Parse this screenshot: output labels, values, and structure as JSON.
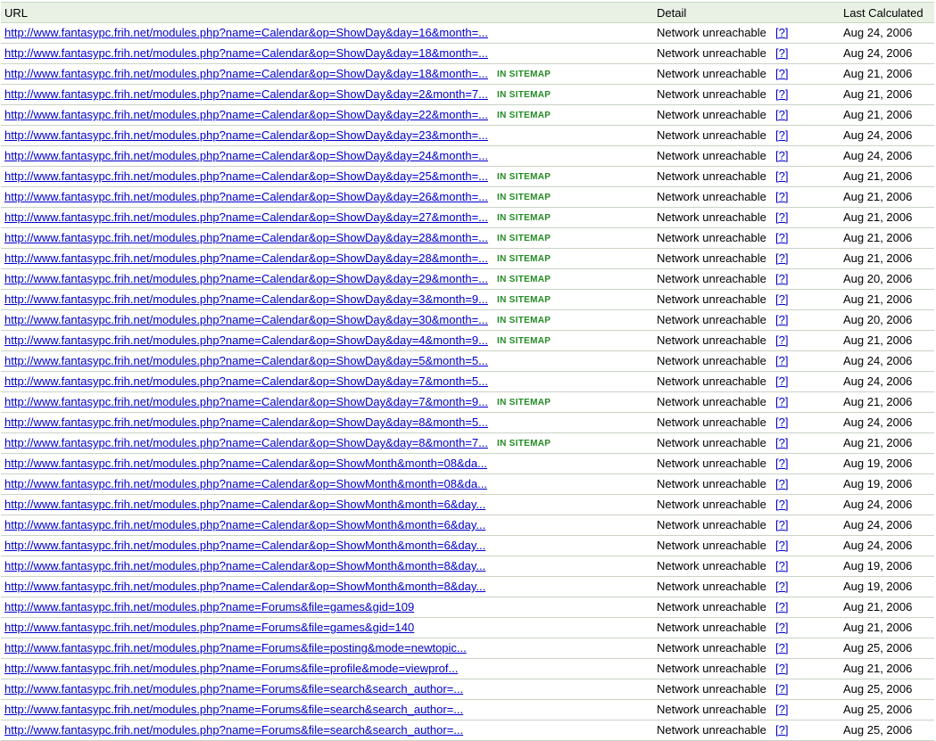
{
  "headers": {
    "url": "URL",
    "detail": "Detail",
    "last_calculated": "Last Calculated"
  },
  "sitemap_label": "IN SITEMAP",
  "help_label": "[?]",
  "colors": {
    "link": "#0000cc",
    "sitemap": "#228b22",
    "header_bg": "#e9f1e5",
    "row_border": "#c9d3c5"
  },
  "rows": [
    {
      "url": "http://www.fantasypc.frih.net/modules.php?name=Calendar&op=ShowDay&day=16&month=...",
      "sitemap": false,
      "detail": "Network unreachable",
      "date": "Aug 24, 2006"
    },
    {
      "url": "http://www.fantasypc.frih.net/modules.php?name=Calendar&op=ShowDay&day=18&month=...",
      "sitemap": false,
      "detail": "Network unreachable",
      "date": "Aug 24, 2006"
    },
    {
      "url": "http://www.fantasypc.frih.net/modules.php?name=Calendar&op=ShowDay&day=18&month=...",
      "sitemap": true,
      "detail": "Network unreachable",
      "date": "Aug 21, 2006"
    },
    {
      "url": "http://www.fantasypc.frih.net/modules.php?name=Calendar&op=ShowDay&day=2&month=7...",
      "sitemap": true,
      "detail": "Network unreachable",
      "date": "Aug 21, 2006"
    },
    {
      "url": "http://www.fantasypc.frih.net/modules.php?name=Calendar&op=ShowDay&day=22&month=...",
      "sitemap": true,
      "detail": "Network unreachable",
      "date": "Aug 21, 2006"
    },
    {
      "url": "http://www.fantasypc.frih.net/modules.php?name=Calendar&op=ShowDay&day=23&month=...",
      "sitemap": false,
      "detail": "Network unreachable",
      "date": "Aug 24, 2006"
    },
    {
      "url": "http://www.fantasypc.frih.net/modules.php?name=Calendar&op=ShowDay&day=24&month=...",
      "sitemap": false,
      "detail": "Network unreachable",
      "date": "Aug 24, 2006"
    },
    {
      "url": "http://www.fantasypc.frih.net/modules.php?name=Calendar&op=ShowDay&day=25&month=...",
      "sitemap": true,
      "detail": "Network unreachable",
      "date": "Aug 21, 2006"
    },
    {
      "url": "http://www.fantasypc.frih.net/modules.php?name=Calendar&op=ShowDay&day=26&month=...",
      "sitemap": true,
      "detail": "Network unreachable",
      "date": "Aug 21, 2006"
    },
    {
      "url": "http://www.fantasypc.frih.net/modules.php?name=Calendar&op=ShowDay&day=27&month=...",
      "sitemap": true,
      "detail": "Network unreachable",
      "date": "Aug 21, 2006"
    },
    {
      "url": "http://www.fantasypc.frih.net/modules.php?name=Calendar&op=ShowDay&day=28&month=...",
      "sitemap": true,
      "detail": "Network unreachable",
      "date": "Aug 21, 2006"
    },
    {
      "url": "http://www.fantasypc.frih.net/modules.php?name=Calendar&op=ShowDay&day=28&month=...",
      "sitemap": true,
      "detail": "Network unreachable",
      "date": "Aug 21, 2006"
    },
    {
      "url": "http://www.fantasypc.frih.net/modules.php?name=Calendar&op=ShowDay&day=29&month=...",
      "sitemap": true,
      "detail": "Network unreachable",
      "date": "Aug 20, 2006"
    },
    {
      "url": "http://www.fantasypc.frih.net/modules.php?name=Calendar&op=ShowDay&day=3&month=9...",
      "sitemap": true,
      "detail": "Network unreachable",
      "date": "Aug 21, 2006"
    },
    {
      "url": "http://www.fantasypc.frih.net/modules.php?name=Calendar&op=ShowDay&day=30&month=...",
      "sitemap": true,
      "detail": "Network unreachable",
      "date": "Aug 20, 2006"
    },
    {
      "url": "http://www.fantasypc.frih.net/modules.php?name=Calendar&op=ShowDay&day=4&month=9...",
      "sitemap": true,
      "detail": "Network unreachable",
      "date": "Aug 21, 2006"
    },
    {
      "url": "http://www.fantasypc.frih.net/modules.php?name=Calendar&op=ShowDay&day=5&month=5...",
      "sitemap": false,
      "detail": "Network unreachable",
      "date": "Aug 24, 2006"
    },
    {
      "url": "http://www.fantasypc.frih.net/modules.php?name=Calendar&op=ShowDay&day=7&month=5...",
      "sitemap": false,
      "detail": "Network unreachable",
      "date": "Aug 24, 2006"
    },
    {
      "url": "http://www.fantasypc.frih.net/modules.php?name=Calendar&op=ShowDay&day=7&month=9...",
      "sitemap": true,
      "detail": "Network unreachable",
      "date": "Aug 21, 2006"
    },
    {
      "url": "http://www.fantasypc.frih.net/modules.php?name=Calendar&op=ShowDay&day=8&month=5...",
      "sitemap": false,
      "detail": "Network unreachable",
      "date": "Aug 24, 2006"
    },
    {
      "url": "http://www.fantasypc.frih.net/modules.php?name=Calendar&op=ShowDay&day=8&month=7...",
      "sitemap": true,
      "detail": "Network unreachable",
      "date": "Aug 21, 2006"
    },
    {
      "url": "http://www.fantasypc.frih.net/modules.php?name=Calendar&op=ShowMonth&month=08&da...",
      "sitemap": false,
      "detail": "Network unreachable",
      "date": "Aug 19, 2006"
    },
    {
      "url": "http://www.fantasypc.frih.net/modules.php?name=Calendar&op=ShowMonth&month=08&da...",
      "sitemap": false,
      "detail": "Network unreachable",
      "date": "Aug 19, 2006"
    },
    {
      "url": "http://www.fantasypc.frih.net/modules.php?name=Calendar&op=ShowMonth&month=6&day...",
      "sitemap": false,
      "detail": "Network unreachable",
      "date": "Aug 24, 2006"
    },
    {
      "url": "http://www.fantasypc.frih.net/modules.php?name=Calendar&op=ShowMonth&month=6&day...",
      "sitemap": false,
      "detail": "Network unreachable",
      "date": "Aug 24, 2006"
    },
    {
      "url": "http://www.fantasypc.frih.net/modules.php?name=Calendar&op=ShowMonth&month=6&day...",
      "sitemap": false,
      "detail": "Network unreachable",
      "date": "Aug 24, 2006"
    },
    {
      "url": "http://www.fantasypc.frih.net/modules.php?name=Calendar&op=ShowMonth&month=8&day...",
      "sitemap": false,
      "detail": "Network unreachable",
      "date": "Aug 19, 2006"
    },
    {
      "url": "http://www.fantasypc.frih.net/modules.php?name=Calendar&op=ShowMonth&month=8&day...",
      "sitemap": false,
      "detail": "Network unreachable",
      "date": "Aug 19, 2006"
    },
    {
      "url": "http://www.fantasypc.frih.net/modules.php?name=Forums&file=games&gid=109",
      "sitemap": false,
      "detail": "Network unreachable",
      "date": "Aug 21, 2006"
    },
    {
      "url": "http://www.fantasypc.frih.net/modules.php?name=Forums&file=games&gid=140",
      "sitemap": false,
      "detail": "Network unreachable",
      "date": "Aug 21, 2006"
    },
    {
      "url": "http://www.fantasypc.frih.net/modules.php?name=Forums&file=posting&mode=newtopic...",
      "sitemap": false,
      "detail": "Network unreachable",
      "date": "Aug 25, 2006"
    },
    {
      "url": "http://www.fantasypc.frih.net/modules.php?name=Forums&file=profile&mode=viewprof...",
      "sitemap": false,
      "detail": "Network unreachable",
      "date": "Aug 21, 2006"
    },
    {
      "url": "http://www.fantasypc.frih.net/modules.php?name=Forums&file=search&search_author=...",
      "sitemap": false,
      "detail": "Network unreachable",
      "date": "Aug 25, 2006"
    },
    {
      "url": "http://www.fantasypc.frih.net/modules.php?name=Forums&file=search&search_author=...",
      "sitemap": false,
      "detail": "Network unreachable",
      "date": "Aug 25, 2006"
    },
    {
      "url": "http://www.fantasypc.frih.net/modules.php?name=Forums&file=search&search_author=...",
      "sitemap": false,
      "detail": "Network unreachable",
      "date": "Aug 25, 2006"
    }
  ]
}
